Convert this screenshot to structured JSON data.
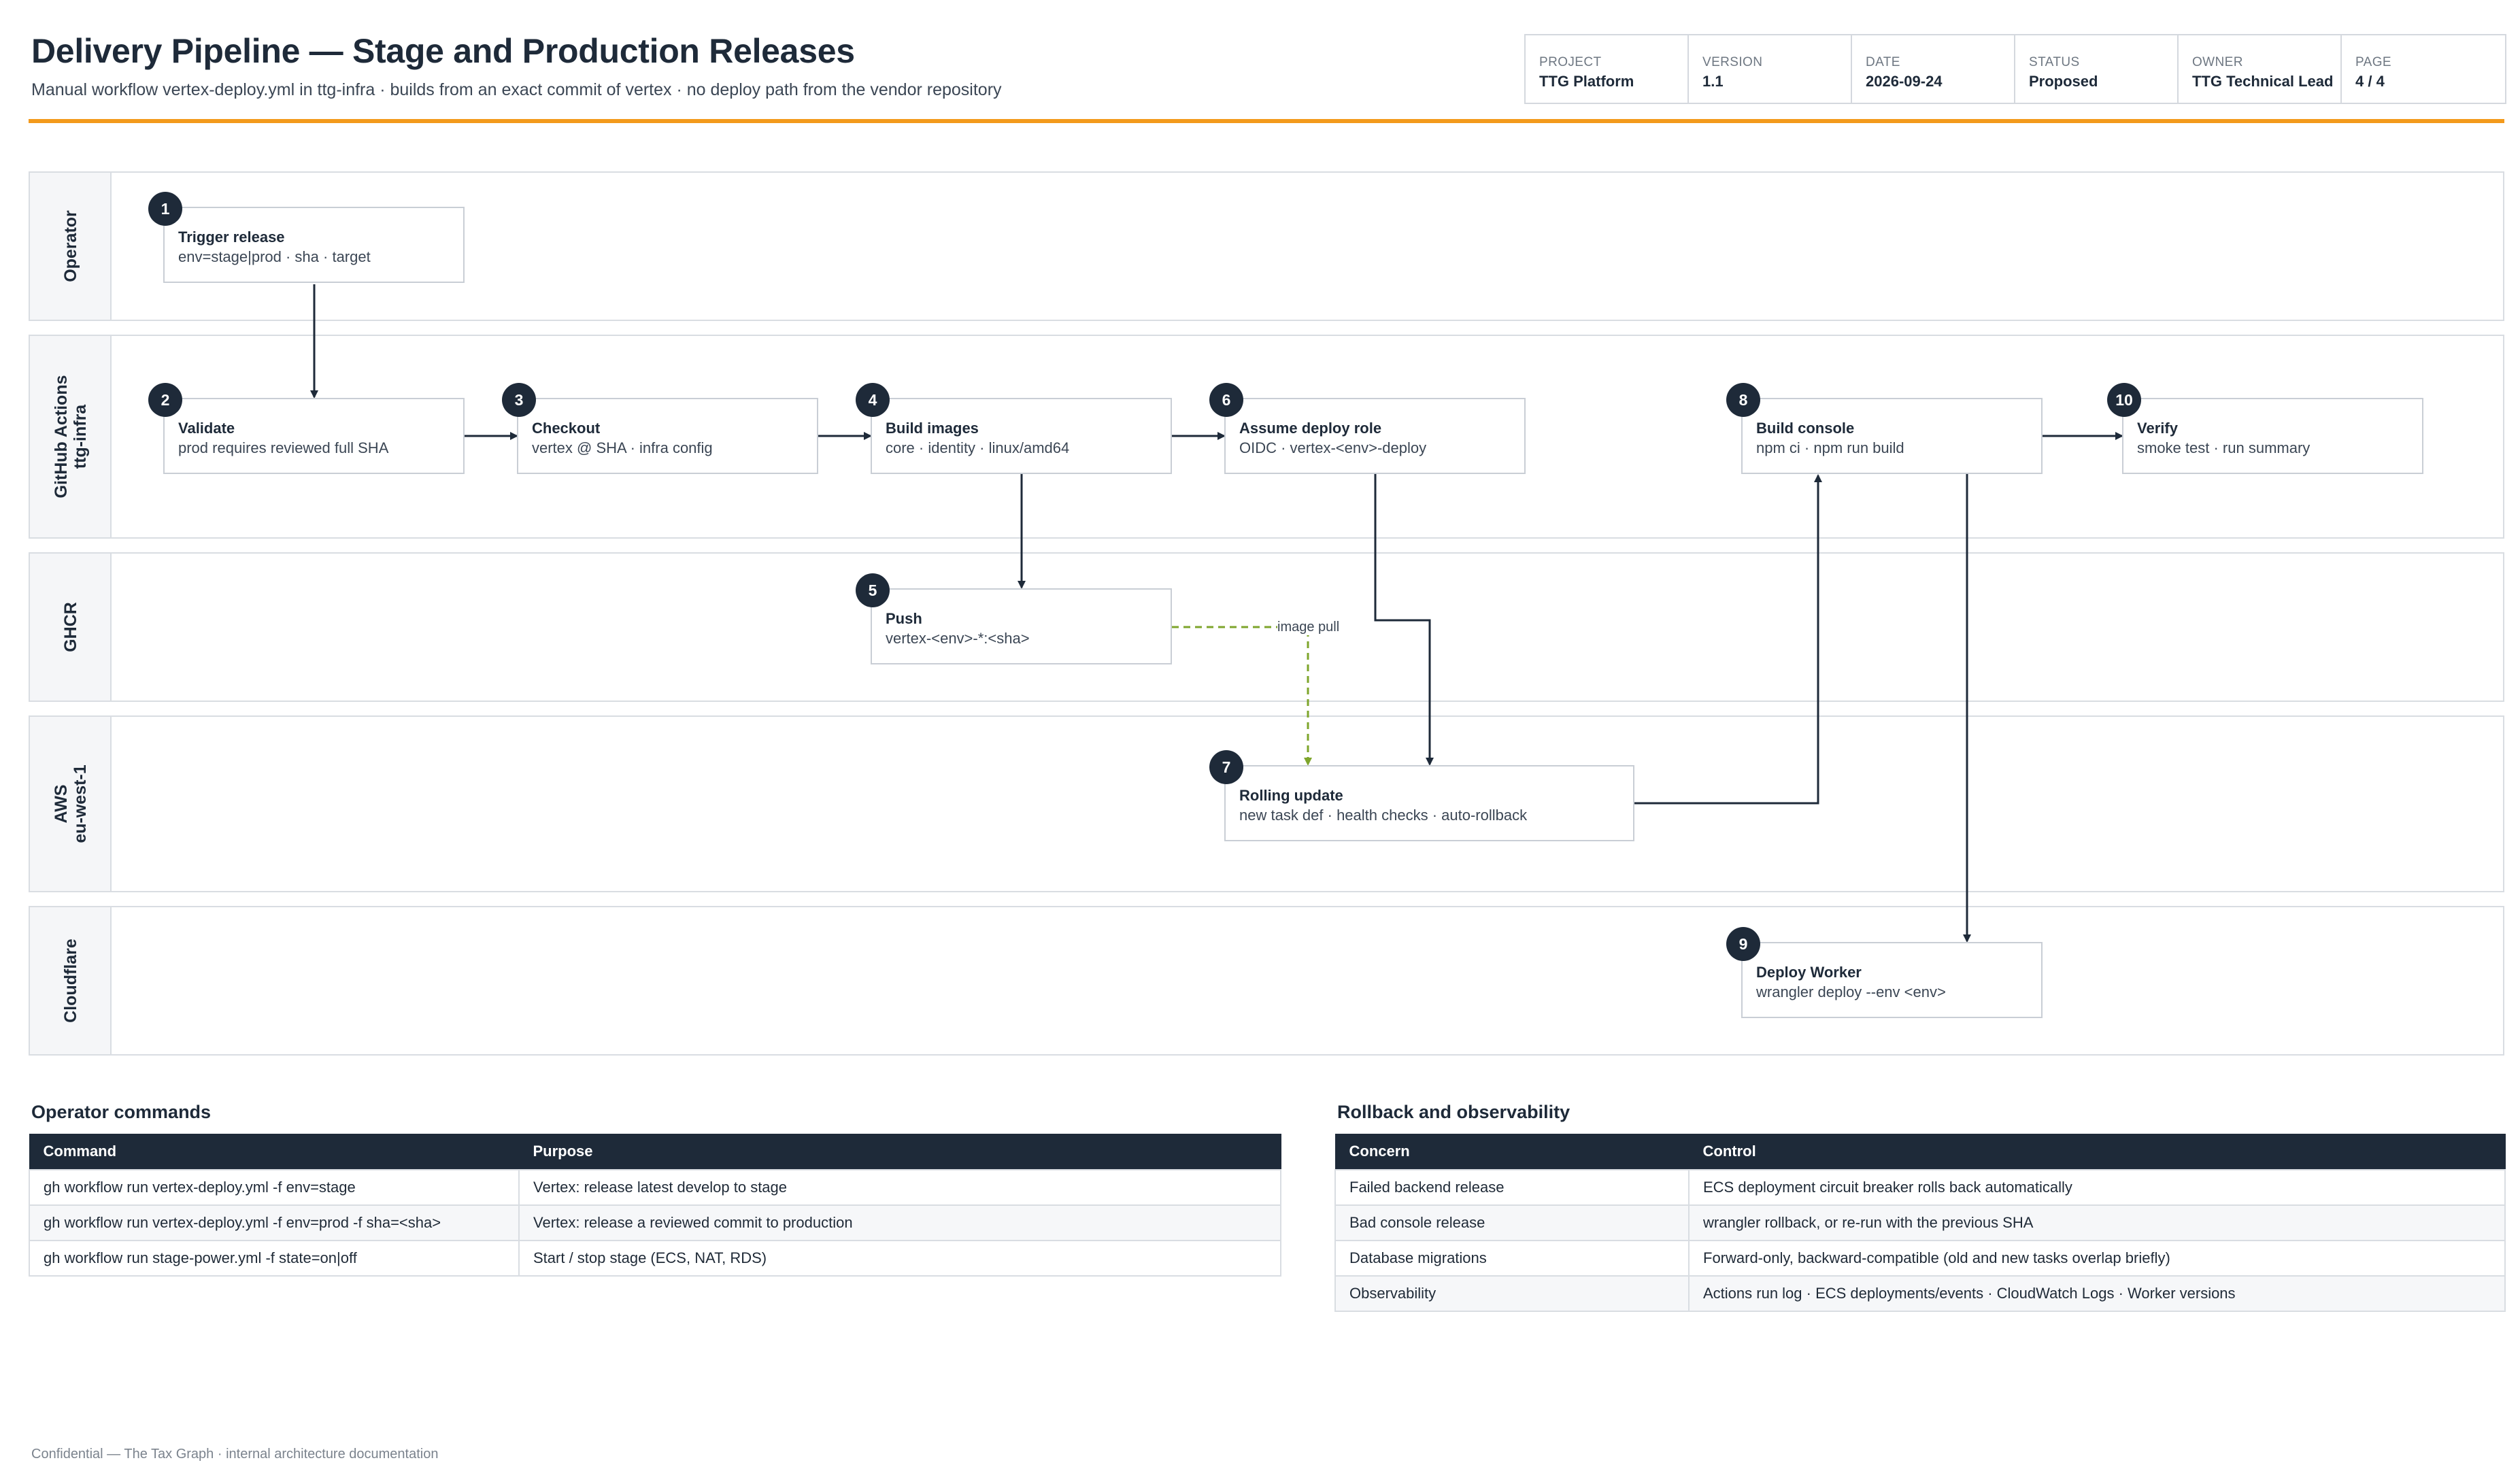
{
  "header": {
    "title": "Delivery Pipeline — Stage and Production Releases",
    "subtitle": "Manual workflow vertex-deploy.yml in ttg-infra · builds from an exact commit of vertex · no deploy path from the vendor repository"
  },
  "meta": [
    {
      "key": "PROJECT",
      "value": "TTG Platform"
    },
    {
      "key": "VERSION",
      "value": "1.1"
    },
    {
      "key": "DATE",
      "value": "2026-09-24"
    },
    {
      "key": "STATUS",
      "value": "Proposed"
    },
    {
      "key": "OWNER",
      "value": "TTG Technical Lead"
    },
    {
      "key": "PAGE",
      "value": "4 / 4"
    }
  ],
  "lanes": [
    {
      "id": "operator",
      "line1": "Operator",
      "line2": ""
    },
    {
      "id": "github",
      "line1": "GitHub Actions",
      "line2": "ttg-infra"
    },
    {
      "id": "ghcr",
      "line1": "GHCR",
      "line2": ""
    },
    {
      "id": "aws",
      "line1": "AWS",
      "line2": "eu-west-1"
    },
    {
      "id": "cloudflare",
      "line1": "Cloudflare",
      "line2": ""
    }
  ],
  "steps": [
    {
      "num": "1",
      "title": "Trigger release",
      "detail": "env=stage|prod · sha · target",
      "lane": "operator"
    },
    {
      "num": "2",
      "title": "Validate",
      "detail": "prod requires reviewed full SHA",
      "lane": "github"
    },
    {
      "num": "3",
      "title": "Checkout",
      "detail": "vertex @ SHA · infra config",
      "lane": "github"
    },
    {
      "num": "4",
      "title": "Build images",
      "detail": "core · identity · linux/amd64",
      "lane": "github"
    },
    {
      "num": "5",
      "title": "Push",
      "detail": "vertex-<env>-*:<sha>",
      "lane": "ghcr"
    },
    {
      "num": "6",
      "title": "Assume deploy role",
      "detail": "OIDC · vertex-<env>-deploy",
      "lane": "github"
    },
    {
      "num": "7",
      "title": "Rolling update",
      "detail": "new task def · health checks · auto-rollback",
      "lane": "aws"
    },
    {
      "num": "8",
      "title": "Build console",
      "detail": "npm ci · npm run build",
      "lane": "github"
    },
    {
      "num": "9",
      "title": "Deploy Worker",
      "detail": "wrangler deploy --env <env>",
      "lane": "cloudflare"
    },
    {
      "num": "10",
      "title": "Verify",
      "detail": "smoke test · run summary",
      "lane": "github"
    }
  ],
  "edges": [
    {
      "from": "1",
      "to": "2",
      "style": "solid",
      "label": ""
    },
    {
      "from": "2",
      "to": "3",
      "style": "solid",
      "label": ""
    },
    {
      "from": "3",
      "to": "4",
      "style": "solid",
      "label": ""
    },
    {
      "from": "4",
      "to": "5",
      "style": "solid",
      "label": ""
    },
    {
      "from": "4",
      "to": "6",
      "style": "solid",
      "label": ""
    },
    {
      "from": "5",
      "to": "7",
      "style": "dashed",
      "label": "image pull"
    },
    {
      "from": "6",
      "to": "7",
      "style": "solid",
      "label": ""
    },
    {
      "from": "7",
      "to": "8",
      "style": "solid",
      "label": ""
    },
    {
      "from": "8",
      "to": "9",
      "style": "solid",
      "label": ""
    },
    {
      "from": "8",
      "to": "10",
      "style": "solid",
      "label": ""
    }
  ],
  "colors": {
    "accent": "#f39a1c",
    "navy": "#1e2a39",
    "dashed_edge": "#7ea52b"
  },
  "operator_commands": {
    "title": "Operator commands",
    "columns": [
      "Command",
      "Purpose"
    ],
    "rows": [
      [
        "gh workflow run vertex-deploy.yml -f env=stage",
        "Vertex: release latest develop to stage"
      ],
      [
        "gh workflow run vertex-deploy.yml -f env=prod -f sha=<sha>",
        "Vertex: release a reviewed commit to production"
      ],
      [
        "gh workflow run stage-power.yml -f state=on|off",
        "Start / stop stage (ECS, NAT, RDS)"
      ]
    ]
  },
  "rollback": {
    "title": "Rollback and observability",
    "columns": [
      "Concern",
      "Control"
    ],
    "rows": [
      [
        "Failed backend release",
        "ECS deployment circuit breaker rolls back automatically"
      ],
      [
        "Bad console release",
        "wrangler rollback, or re-run with the previous SHA"
      ],
      [
        "Database migrations",
        "Forward-only, backward-compatible (old and new tasks overlap briefly)"
      ],
      [
        "Observability",
        "Actions run log · ECS deployments/events · CloudWatch Logs · Worker versions"
      ]
    ]
  },
  "footer": "Confidential — The Tax Graph · internal architecture documentation"
}
